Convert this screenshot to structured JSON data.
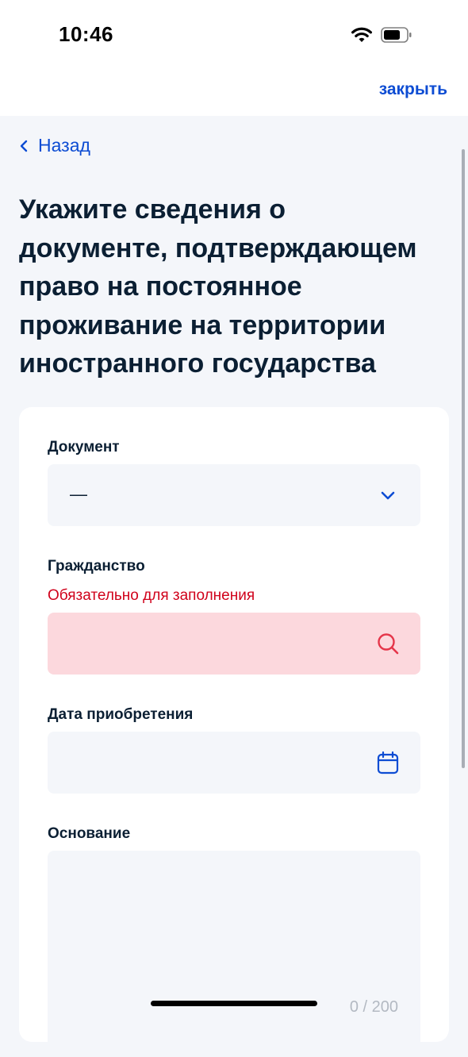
{
  "status": {
    "time": "10:46"
  },
  "header": {
    "close_label": "закрыть"
  },
  "nav": {
    "back_label": "Назад"
  },
  "page": {
    "title": "Укажите сведения о документе, подтверждающем право на постоянное проживание на территории иностранного государства"
  },
  "form": {
    "document": {
      "label": "Документ",
      "value": "—"
    },
    "citizenship": {
      "label": "Гражданство",
      "error": "Обязательно для заполнения",
      "value": ""
    },
    "acquisition_date": {
      "label": "Дата приобретения",
      "value": ""
    },
    "basis": {
      "label": "Основание",
      "value": "",
      "counter": "0 / 200"
    }
  },
  "colors": {
    "accent": "#0D4CD3",
    "error": "#D0021B",
    "error_bg": "#FCD8DD",
    "field_bg": "#F4F6FA",
    "text": "#0B1F33"
  },
  "icons": [
    "wifi-icon",
    "battery-icon",
    "chevron-left-icon",
    "chevron-down-icon",
    "search-icon",
    "calendar-icon"
  ]
}
